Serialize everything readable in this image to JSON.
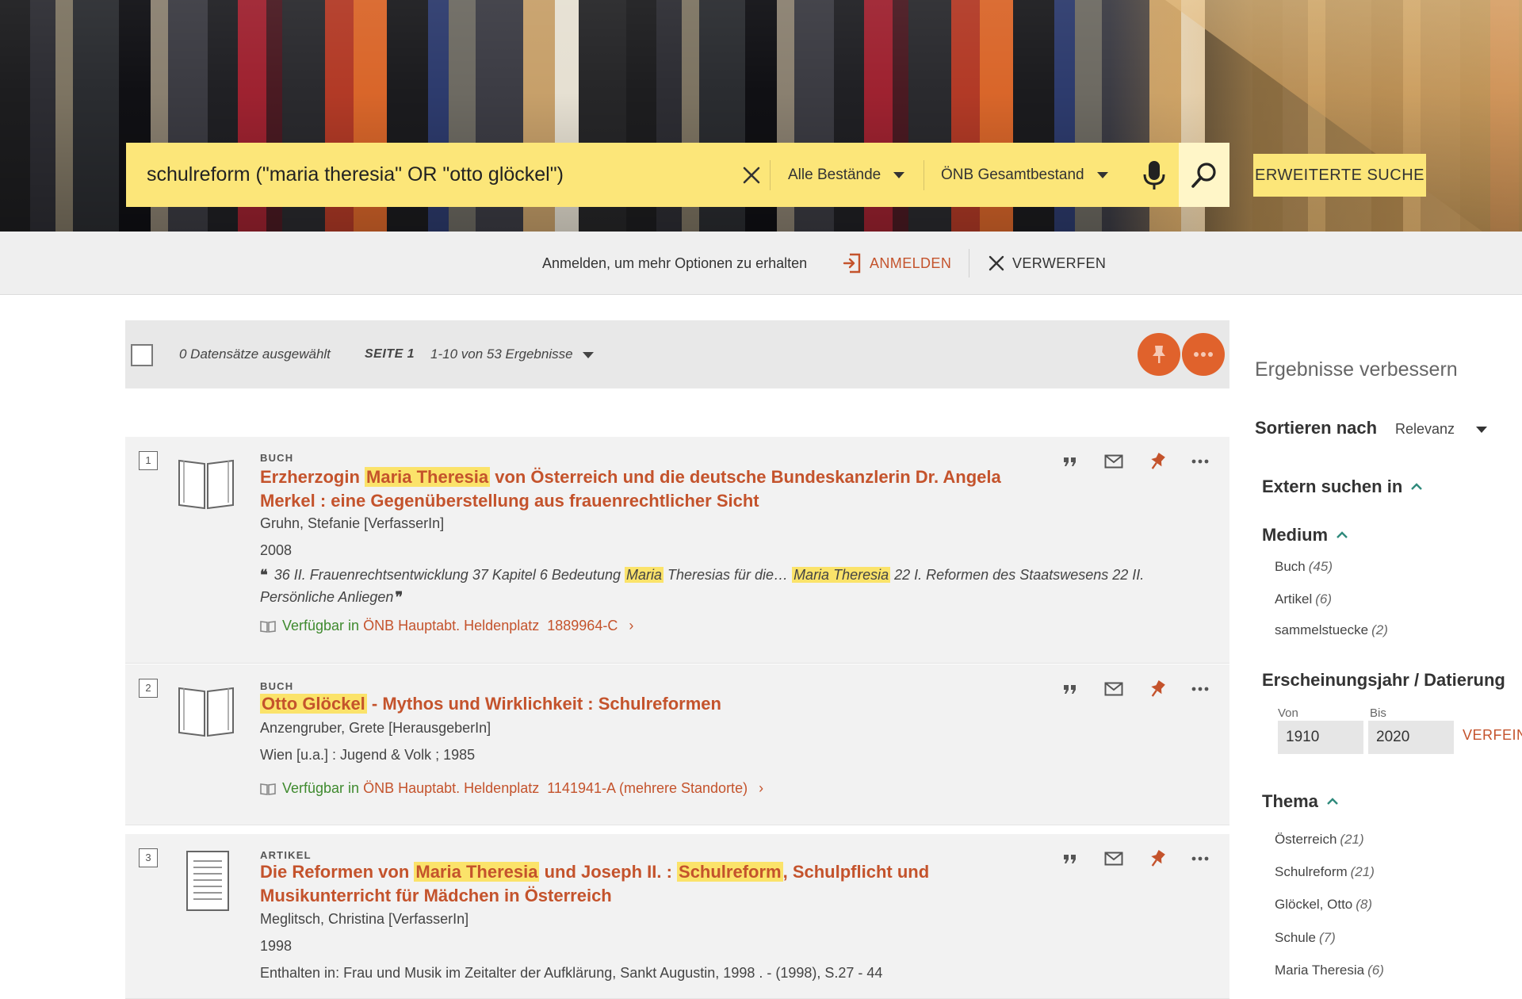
{
  "search": {
    "query": "schulreform (\"maria theresia\" OR \"otto glöckel\")",
    "scope1": "Alle Bestände",
    "scope2": "ÖNB Gesamtbestand",
    "advanced_label": "ERWEITERTE SUCHE"
  },
  "login_bar": {
    "message": "Anmelden, um mehr Optionen zu erhalten",
    "login_label": "ANMELDEN",
    "dismiss_label": "VERWERFEN"
  },
  "toolbar": {
    "selected": "0 Datensätze ausgewählt",
    "page": "SEITE 1",
    "range": "1-10 von 53 Ergebnisse"
  },
  "results": [
    {
      "number": "1",
      "type": "BUCH",
      "title_parts": [
        "Erzherzogin ",
        "Maria Theresia",
        " von Österreich und die deutsche Bundeskanzlerin Dr. Angela Merkel : eine Gegenüberstellung aus frauenrechtlicher Sicht"
      ],
      "author": "Gruhn, Stefanie [VerfasserIn]",
      "year": "2008",
      "snippet_parts": [
        "36 II. Frauenrechtsentwicklung 37 Kapitel 6 Bedeutung ",
        "Maria",
        " Theresias für die… ",
        "Maria Theresia",
        " 22 I. Reformen des Staatswesens 22 II. Persönliche Anliegen"
      ],
      "available_label": "Verfügbar in",
      "location": "ÖNB Hauptabt. Heldenplatz",
      "callnumber": "1889964-C"
    },
    {
      "number": "2",
      "type": "BUCH",
      "title_parts": [
        "Otto Glöckel",
        " - Mythos und Wirklichkeit : Schulreformen"
      ],
      "author": "Anzengruber, Grete [HerausgeberIn]",
      "publisher": "Wien [u.a.] : Jugend & Volk ; 1985",
      "available_label": "Verfügbar in",
      "location": "ÖNB Hauptabt. Heldenplatz",
      "callnumber": "1141941-A (mehrere Standorte)"
    },
    {
      "number": "3",
      "type": "ARTIKEL",
      "title_parts": [
        "Die Reformen von ",
        "Maria Theresia",
        " und Joseph II. : ",
        "Schulreform",
        ", Schulpflicht und Musikunterricht für Mädchen in Österreich"
      ],
      "author": "Meglitsch, Christina [VerfasserIn]",
      "year": "1998",
      "source": "Enthalten in: Frau und Musik im Zeitalter der Aufklärung, Sankt Augustin, 1998 . - (1998), S.27 - 44"
    }
  ],
  "sidebar": {
    "heading": "Ergebnisse verbessern",
    "sort_label": "Sortieren nach",
    "sort_value": "Relevanz",
    "extern": "Extern suchen in",
    "medium": {
      "title": "Medium",
      "items": [
        {
          "label": "Buch",
          "count": "(45)"
        },
        {
          "label": "Artikel",
          "count": "(6)"
        },
        {
          "label": "sammelstuecke",
          "count": "(2)"
        }
      ]
    },
    "years": {
      "title": "Erscheinungsjahr / Datierung",
      "from_label": "Von",
      "to_label": "Bis",
      "from": "1910",
      "to": "2020",
      "refine_label": "VERFEINERN"
    },
    "thema": {
      "title": "Thema",
      "items": [
        {
          "label": "Österreich",
          "count": "(21)"
        },
        {
          "label": "Schulreform",
          "count": "(21)"
        },
        {
          "label": "Glöckel, Otto",
          "count": "(8)"
        },
        {
          "label": "Schule",
          "count": "(7)"
        },
        {
          "label": "Maria Theresia",
          "count": "(6)"
        }
      ]
    }
  },
  "colors": {
    "accent": "#c4532c",
    "search_yellow": "#fce679",
    "highlight": "#fbe36a",
    "available_green": "#3f8a2e"
  },
  "icons": [
    "clear-icon",
    "caret-down-icon",
    "microphone-icon",
    "search-icon",
    "login-icon",
    "close-icon",
    "pin-icon",
    "more-icon",
    "book-icon",
    "article-icon",
    "cite-icon",
    "email-icon",
    "library-icon",
    "chevron-right-icon",
    "chevron-up-icon"
  ]
}
